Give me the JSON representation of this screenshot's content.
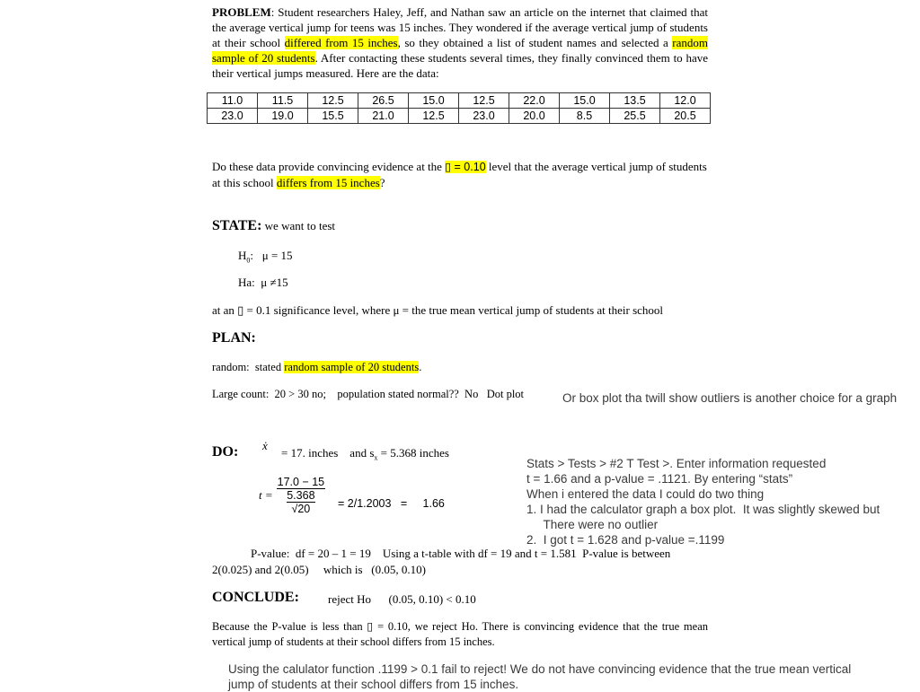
{
  "problem": {
    "label": "PROBLEM",
    "text_1": ": Student researchers Haley, Jeff, and Nathan saw an article on the internet that claimed that the average vertical jump for teens was 15 inches. They wondered if the average vertical jump of students at their school ",
    "highlight_1": "differed from 15 inches",
    "text_2": ", so they obtained a list of student names and selected a ",
    "highlight_2": "random sample of 20 students",
    "text_3": ". After contacting these students several times, they finally convinced them to have their vertical jumps measured. Here are the data:"
  },
  "data_table": {
    "rows": [
      [
        "11.0",
        "11.5",
        "12.5",
        "26.5",
        "15.0",
        "12.5",
        "22.0",
        "15.0",
        "13.5",
        "12.0"
      ],
      [
        "23.0",
        "19.0",
        "15.5",
        "21.0",
        "12.5",
        "23.0",
        "20.0",
        "8.5",
        "25.5",
        "20.5"
      ]
    ]
  },
  "question": {
    "text_1": "Do these data provide convincing evidence at the ",
    "highlight_1": "▯ = 0.10",
    "text_2": " level that the average vertical jump of students at this school ",
    "highlight_2": "differs from 15 inches",
    "text_3": "?"
  },
  "state": {
    "heading": "STATE:",
    "intro": " we want to test",
    "h0_label": "H",
    "h0_sub": "0",
    "h0_text": ":   μ = 15",
    "ha_text": "Ha:  μ ≠15",
    "significance": "at an ▯ = 0.1 significance level, where μ = the true mean vertical jump of students at their school"
  },
  "plan": {
    "heading": "PLAN:",
    "random_label": "random:  stated ",
    "random_highlight": "random sample of 20 students",
    "random_end": ".",
    "large_count": "Large count:  20 > 30 no;    population stated normal??  No   Dot plot",
    "note": "Or box plot tha twill show outliers is another choice for a graph"
  },
  "do": {
    "heading": "DO:",
    "xbar_symbol": "ẋ",
    "mean_text": "= 17. inches    and s",
    "sx_sub": "x",
    "sd_text": " = 5.368 inches",
    "t_label": "t =",
    "t_numerator": "17.0 − 15",
    "t_den_top": "5.368",
    "t_den_bottom": "√20",
    "t_result": "= 2/1.2003   =     1.66",
    "pvalue_line_1": "P-value:  df = 20 – 1 = 19    Using a t-table with df = 19 and t = 1.581  P-value is between",
    "pvalue_line_2": "2(0.025) and 2(0.05)     which is   (0.05, 0.10)",
    "calculator_notes": [
      "Stats > Tests > #2 T Test >. Enter information requested",
      "t = 1.66 and a p-value = .1121. By entering “stats”",
      "When i entered the data I could do two thing",
      "1. I had the calculator graph a box plot.  It was slightly skewed but",
      "     There were no outlier",
      "2.  I got t = 1.628 and p-value =.1199"
    ]
  },
  "conclude": {
    "heading": "CONCLUDE:",
    "decision": "reject Ho      (0.05, 0.10) < 0.10",
    "paragraph": "Because the P-value is less than ▯ = 0.10, we reject Ho.  There is convincing evidence that the true mean vertical jump of students at their school differs from 15 inches.",
    "note": "Using the calulator function  .1199 > 0.1 fail to reject!  We do not have convincing evidence that the true mean vertical jump of students at their school differs from 15 inches."
  },
  "colors": {
    "highlight": "#ffff00",
    "note_text": "#3a3a3a"
  }
}
